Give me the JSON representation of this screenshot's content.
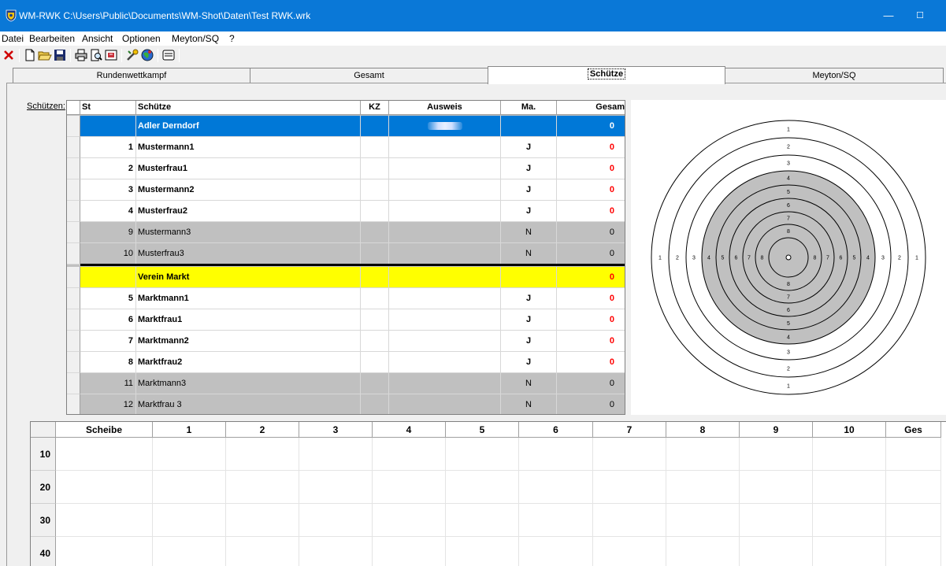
{
  "window": {
    "title": "WM-RWK C:\\Users\\Public\\Documents\\WM-Shot\\Daten\\Test RWK.wrk",
    "minimize_glyph": "—",
    "maximize_glyph": "☐",
    "accent_color": "#0a78d7"
  },
  "menu": [
    "Datei",
    "Bearbeiten",
    "Ansicht",
    "Optionen",
    "Meyton/SQ",
    "?"
  ],
  "toolbar": {
    "icons": [
      "close-icon",
      "new-file-icon",
      "open-folder-icon",
      "save-icon",
      "print-icon",
      "print-preview-icon",
      "export-icon",
      "settings-icon",
      "globe-icon",
      "list-icon"
    ]
  },
  "tabs": [
    {
      "label": "Rundenwettkampf",
      "active": false
    },
    {
      "label": "Gesamt",
      "active": false
    },
    {
      "label": "Schütze",
      "active": true
    },
    {
      "label": "Meyton/SQ",
      "active": false
    }
  ],
  "schuetzen_label": "Schützen:",
  "grid": {
    "headers": {
      "st": "St",
      "name": "Schütze",
      "kz": "KZ",
      "ausweis": "Ausweis",
      "ma": "Ma.",
      "ges": "Gesam"
    },
    "rows": [
      {
        "style": "sel",
        "st": "",
        "name": "Adler Derndorf",
        "kz": "",
        "ausweis_blurred": true,
        "ma": "",
        "ges": "0"
      },
      {
        "style": "white",
        "st": "1",
        "name": "Mustermann1",
        "kz": "",
        "ma": "J",
        "ges": "0"
      },
      {
        "style": "white",
        "st": "2",
        "name": "Musterfrau1",
        "kz": "",
        "ma": "J",
        "ges": "0"
      },
      {
        "style": "white",
        "st": "3",
        "name": "Mustermann2",
        "kz": "",
        "ma": "J",
        "ges": "0"
      },
      {
        "style": "white",
        "st": "4",
        "name": "Musterfrau2",
        "kz": "",
        "ma": "J",
        "ges": "0"
      },
      {
        "style": "gray",
        "st": "9",
        "name": "Mustermann3",
        "kz": "",
        "ma": "N",
        "ges": "0"
      },
      {
        "style": "gray",
        "st": "10",
        "name": "Musterfrau3",
        "kz": "",
        "ma": "N",
        "ges": "0"
      },
      {
        "style": "yellow",
        "st": "",
        "name": "Verein Markt",
        "kz": "",
        "ma": "",
        "ges": "0"
      },
      {
        "style": "white",
        "st": "5",
        "name": "Marktmann1",
        "kz": "",
        "ma": "J",
        "ges": "0"
      },
      {
        "style": "white",
        "st": "6",
        "name": "Marktfrau1",
        "kz": "",
        "ma": "J",
        "ges": "0"
      },
      {
        "style": "white",
        "st": "7",
        "name": "Marktmann2",
        "kz": "",
        "ma": "J",
        "ges": "0"
      },
      {
        "style": "white",
        "st": "8",
        "name": "Marktfrau2",
        "kz": "",
        "ma": "J",
        "ges": "0"
      },
      {
        "style": "gray",
        "st": "11",
        "name": "Marktmann3",
        "kz": "",
        "ma": "N",
        "ges": "0"
      },
      {
        "style": "gray",
        "st": "12",
        "name": "Marktfrau 3",
        "kz": "",
        "ma": "N",
        "ges": "0"
      }
    ]
  },
  "target": {
    "ring_numbers": [
      "1",
      "2",
      "3",
      "4",
      "5",
      "6",
      "7",
      "8"
    ],
    "ring_fill": "#c0c0c0"
  },
  "series": {
    "headers": [
      "Scheibe",
      "1",
      "2",
      "3",
      "4",
      "5",
      "6",
      "7",
      "8",
      "9",
      "10",
      "Ges"
    ],
    "rows": [
      "10",
      "20",
      "30",
      "40"
    ]
  },
  "colors": {
    "selected": "#0078d7",
    "yellow": "#ffff00",
    "gray_row": "#c0c0c0",
    "score_red": "#ff0000"
  }
}
